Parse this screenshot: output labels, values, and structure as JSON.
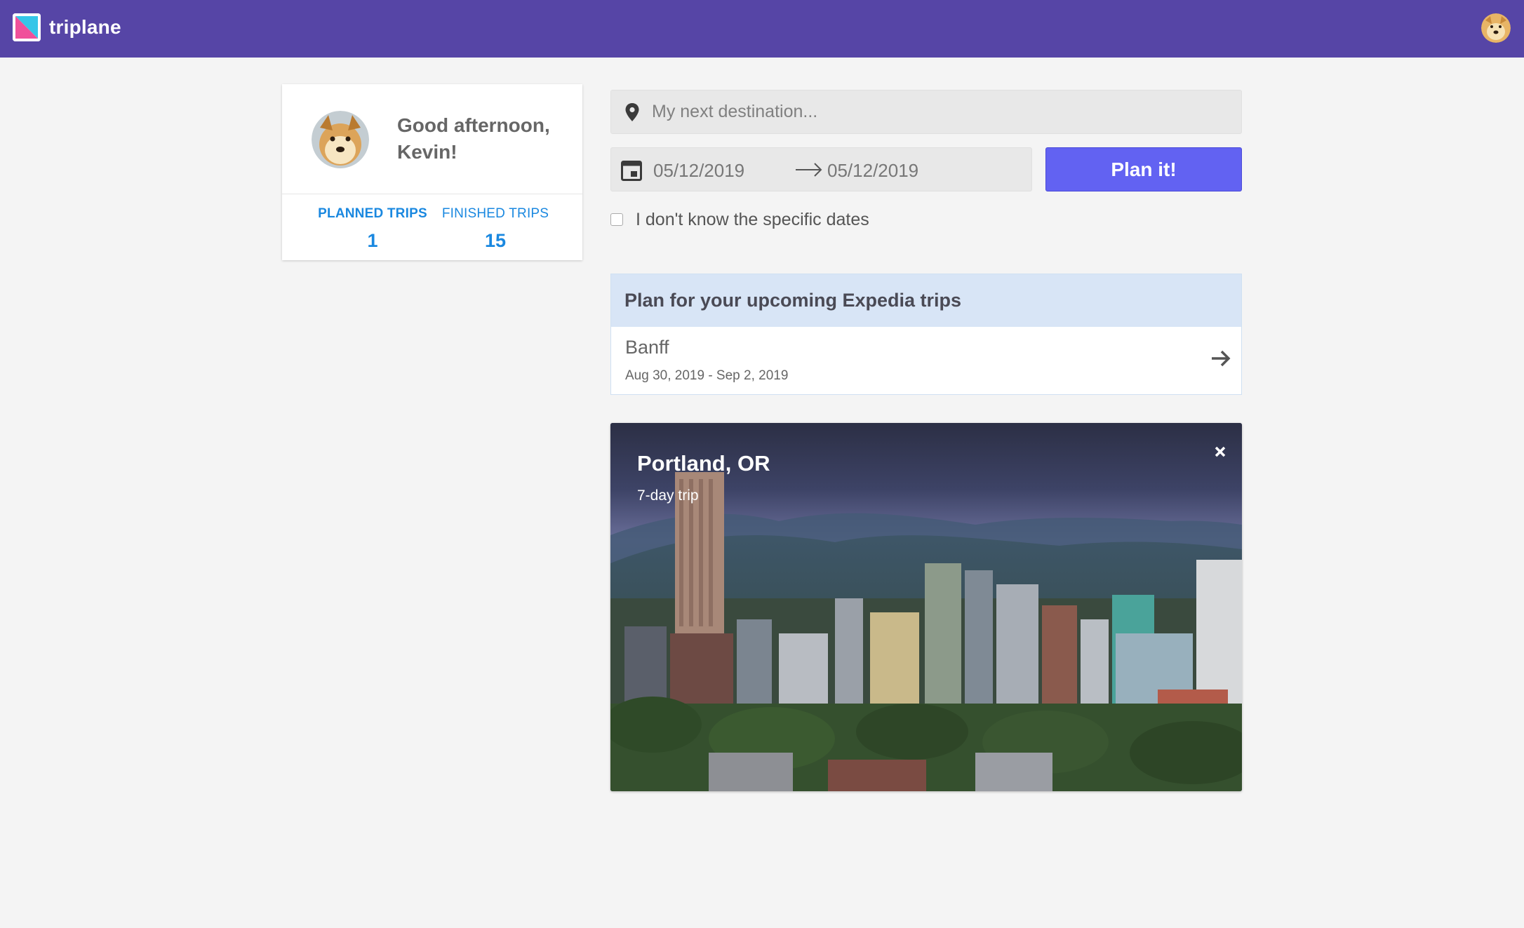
{
  "app": {
    "name": "triplane"
  },
  "colors": {
    "header": "#5645a6",
    "accent": "#6262f2",
    "link": "#1a88e0",
    "expedia_header": "#d8e5f6"
  },
  "profile": {
    "greeting": "Good afternoon, Kevin!",
    "planned_label": "PLANNED TRIPS",
    "planned_count": "1",
    "finished_label": "FINISHED TRIPS",
    "finished_count": "15"
  },
  "search": {
    "destination_placeholder": "My next destination...",
    "start_date": "05/12/2019",
    "end_date": "05/12/2019",
    "plan_button": "Plan it!",
    "no_dates_label": "I don't know the specific dates",
    "no_dates_checked": false
  },
  "expedia": {
    "heading": "Plan for your upcoming Expedia trips",
    "trips": [
      {
        "destination": "Banff",
        "dates": "Aug 30, 2019 - Sep 2, 2019"
      }
    ]
  },
  "trip_card": {
    "title": "Portland, OR",
    "subtitle": "7-day trip"
  },
  "icons": {
    "logo": "triplane-logo",
    "pin": "location-pin-icon",
    "calendar": "calendar-icon",
    "arrow": "arrow-right-icon",
    "close": "close-icon"
  }
}
